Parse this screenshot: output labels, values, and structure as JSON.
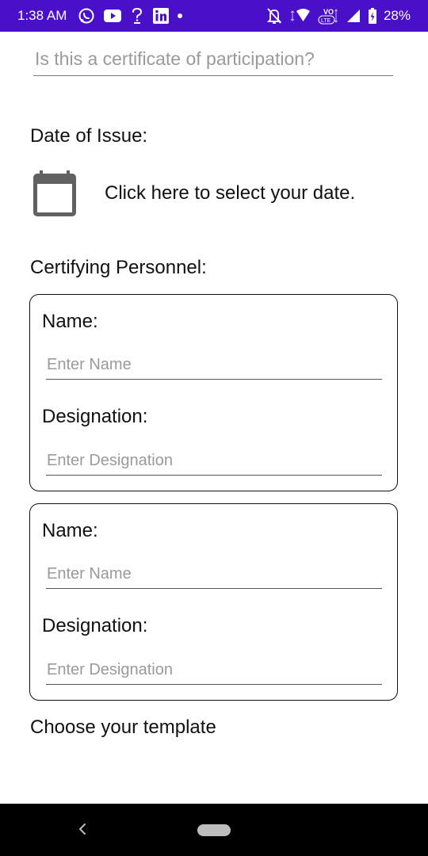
{
  "status_bar": {
    "time": "1:38 AM",
    "network_badge_top": "VO",
    "network_badge_bottom": "LTE",
    "battery": "28%",
    "icons": [
      "whatsapp-icon",
      "youtube-icon",
      "question-icon",
      "linkedin-icon",
      "notification-dot",
      "notifications-off-icon",
      "wifi-icon",
      "volte-icon",
      "signal-icon",
      "battery-charging-icon"
    ]
  },
  "form": {
    "participation_placeholder": "Is this a certificate of participation?",
    "date_label": "Date of Issue:",
    "date_prompt": "Click here to select your date.",
    "personnel_label": "Certifying Personnel:",
    "personnel": [
      {
        "name_label": "Name:",
        "name_placeholder": "Enter Name",
        "designation_label": "Designation:",
        "designation_placeholder": "Enter Designation"
      },
      {
        "name_label": "Name:",
        "name_placeholder": "Enter Name",
        "designation_label": "Designation:",
        "designation_placeholder": "Enter Designation"
      }
    ],
    "template_label": "Choose your template"
  },
  "nav_bar": {
    "icons": [
      "back-icon",
      "home-pill"
    ]
  },
  "colors": {
    "status_bar": "#4a0fc8",
    "icon_grey": "#616161",
    "placeholder": "#9a9a9a",
    "nav_bar": "#000000"
  }
}
